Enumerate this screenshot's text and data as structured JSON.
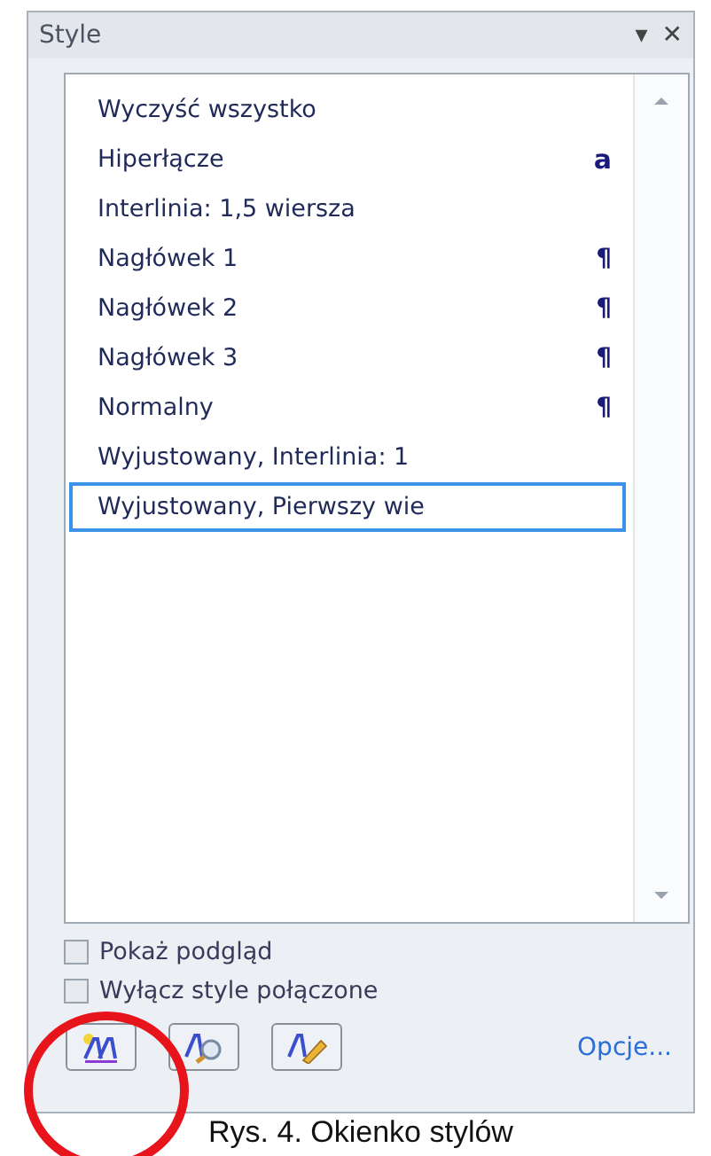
{
  "pane": {
    "title": "Style",
    "menu_icon": "▾",
    "close_icon": "✕"
  },
  "styles": [
    {
      "name": "Wyczyść wszystko",
      "selected": false
    },
    {
      "name": "Hiperłącze",
      "mark": "a",
      "kind": "character",
      "selected": false
    },
    {
      "name": "Interlinia:  1,5 wiersza",
      "selected": false
    },
    {
      "name": "Nagłówek 1",
      "mark": "¶",
      "kind": "paragraph",
      "selected": false
    },
    {
      "name": "Nagłówek 2",
      "mark": "¶",
      "kind": "paragraph",
      "selected": false
    },
    {
      "name": "Nagłówek 3",
      "mark": "¶",
      "kind": "paragraph",
      "selected": false
    },
    {
      "name": "Normalny",
      "mark": "¶",
      "kind": "paragraph",
      "selected": false
    },
    {
      "name": "Wyjustowany, Interlinia:  1",
      "selected": false
    },
    {
      "name": "Wyjustowany, Pierwszy wie",
      "selected": true
    }
  ],
  "options": [
    {
      "label": "Pokaż podgląd",
      "checked": false
    },
    {
      "label": "Wyłącz style połączone",
      "checked": false
    }
  ],
  "link": "Opcje...",
  "caption": "Rys. 4. Okienko stylów"
}
